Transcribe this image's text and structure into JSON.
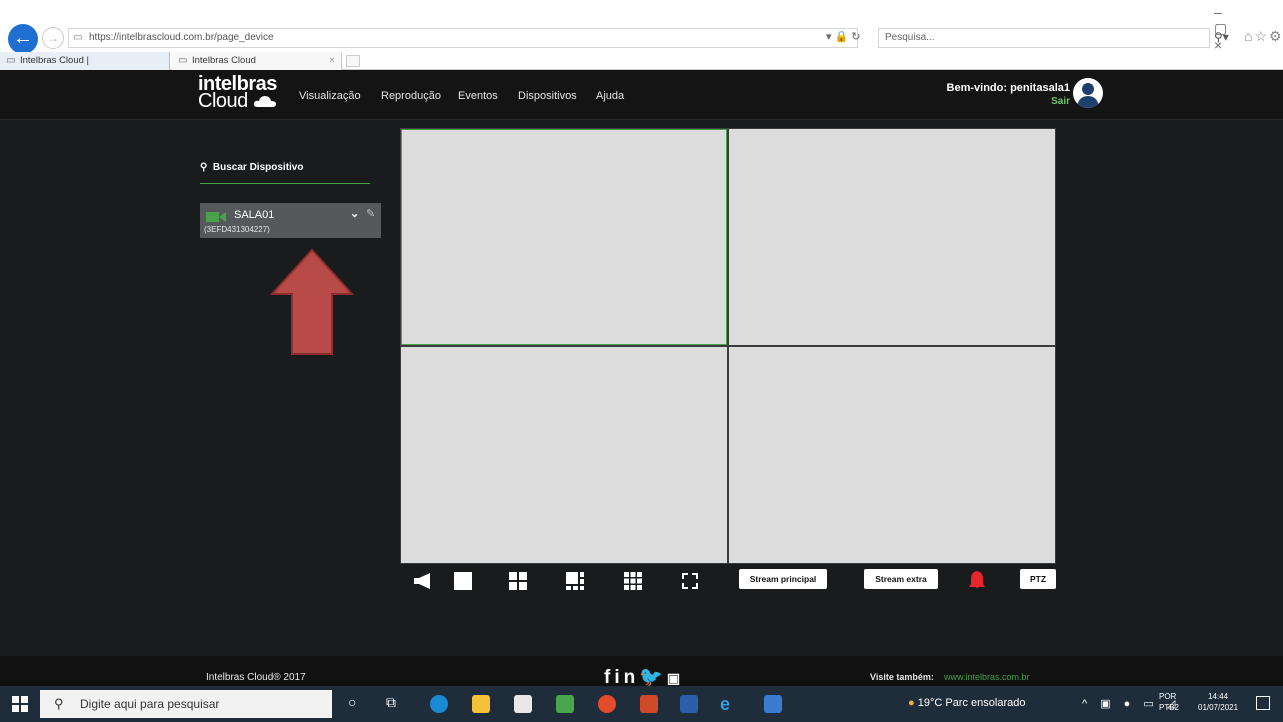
{
  "browser": {
    "back_glyph": "←",
    "fwd_glyph": "→",
    "url": "https://intelbrascloud.com.br/page_device",
    "search_placeholder": "Pesquisa...",
    "tabs": [
      {
        "label": "Intelbras Cloud |"
      },
      {
        "label": "Intelbras Cloud"
      }
    ],
    "tab_close": "×"
  },
  "app": {
    "logo_line1": "intelbras",
    "logo_line2": "Cloud",
    "nav": [
      "Visualização",
      "Reprodução",
      "Eventos",
      "Dispositivos",
      "Ajuda"
    ],
    "welcome": "Bem-vindo: penitasala1",
    "logout": "Sair",
    "search_device": "Buscar Dispositivo",
    "device": {
      "name": "SALA01",
      "serial": "(3EFD431304227)"
    },
    "buttons": {
      "stream_main": "Stream principal",
      "stream_extra": "Stream extra",
      "ptz": "PTZ"
    },
    "footer": {
      "copyright": "Intelbras Cloud® 2017",
      "visit_label": "Visite também:",
      "visit_url": "www.intelbras.com.br"
    },
    "colors": {
      "accent_green": "#49a24a",
      "alarm_red": "#e6262b",
      "arrow_red": "#b84a47"
    }
  },
  "taskbar": {
    "search_placeholder": "Digite aqui para pesquisar",
    "weather": "19°C Parc ensolarado",
    "lang_line1": "POR",
    "lang_line2": "PTB2",
    "time": "14:44",
    "date": "01/07/2021"
  }
}
